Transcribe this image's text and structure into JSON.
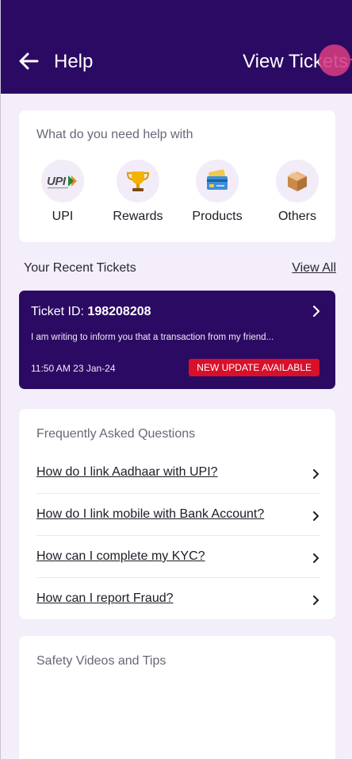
{
  "header": {
    "title": "Help",
    "action_label": "View Tickets"
  },
  "help_section": {
    "title": "What do you need help with",
    "categories": [
      {
        "label": "UPI",
        "icon": "upi-logo"
      },
      {
        "label": "Rewards",
        "icon": "trophy-icon"
      },
      {
        "label": "Products",
        "icon": "credit-card-icon"
      },
      {
        "label": "Others",
        "icon": "box-icon"
      }
    ]
  },
  "recent_tickets": {
    "title": "Your Recent Tickets",
    "view_all_label": "View All",
    "ticket": {
      "id_label": "Ticket ID:",
      "id_value": "198208208",
      "description": "I am writing to inform you that a transaction from my friend...",
      "timestamp": "11:50 AM 23 Jan-24",
      "badge": "NEW UPDATE AVAILABLE"
    }
  },
  "faq": {
    "title": "Frequently Asked Questions",
    "items": [
      {
        "question": "How do I link Aadhaar with UPI?"
      },
      {
        "question": "How do I link mobile with Bank Account?"
      },
      {
        "question": "How can I complete my KYC?"
      },
      {
        "question": "How can I report Fraud?"
      }
    ]
  },
  "safety": {
    "title": "Safety Videos and Tips"
  },
  "colors": {
    "primary": "#2b0a63",
    "badge": "#d8102a",
    "background": "#f3eefa"
  }
}
